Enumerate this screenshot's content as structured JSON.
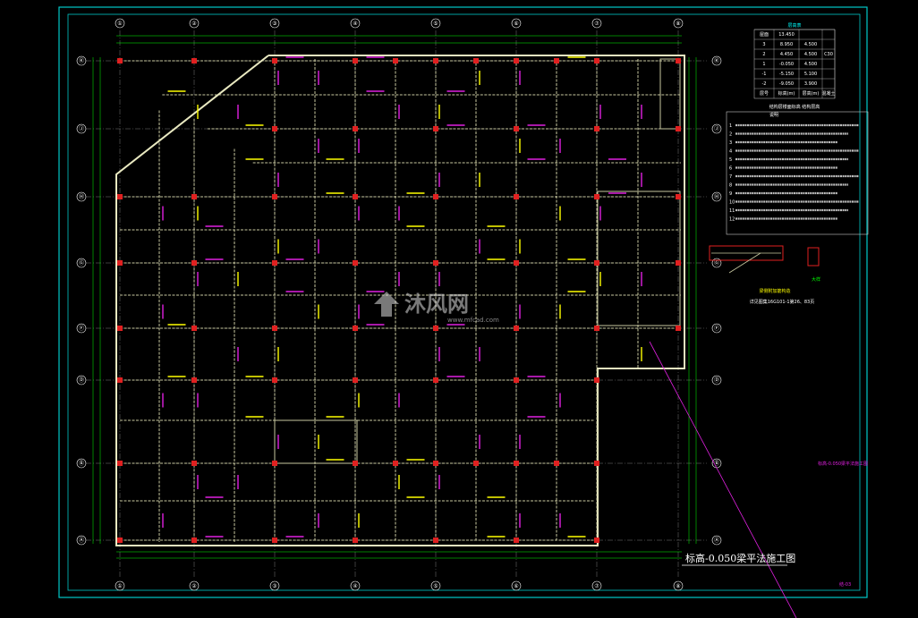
{
  "drawing": {
    "title": "标高-0.050梁平法施工图",
    "grid_columns": [
      "①",
      "②",
      "③",
      "④",
      "⑤",
      "⑥",
      "⑦",
      "⑧"
    ],
    "grid_rows": [
      "Ⓚ",
      "Ⓙ",
      "Ⓗ",
      "Ⓖ",
      "Ⓕ",
      "Ⓓ",
      "Ⓑ",
      "Ⓐ"
    ],
    "side_note": "标高-0.050梁平法施工图",
    "sheet_no": "结-03"
  },
  "level_table": {
    "title": "层高表",
    "rows": [
      [
        "屋面",
        "13.450",
        "",
        ""
      ],
      [
        "3",
        "8.950",
        "4.500",
        ""
      ],
      [
        "2",
        "4.450",
        "4.500",
        "C30"
      ],
      [
        "1",
        "-0.050",
        "4.500",
        ""
      ],
      [
        "-1",
        "-5.150",
        "5.100",
        ""
      ],
      [
        "-2",
        "-9.050",
        "3.900",
        ""
      ],
      [
        "层号",
        "标高(m)",
        "层高(m)",
        "混凝土"
      ]
    ],
    "footer": "结构层楼面标高  结构层高"
  },
  "notes": {
    "title": "说明",
    "count": 12
  },
  "detail": {
    "label_1": "梁侧附加筋构造",
    "label_2": "大样",
    "ref": "详见图集16G101-1第26、83页"
  },
  "watermark": {
    "text": "沐风网",
    "sub": "www.mfcad.com"
  },
  "colors": {
    "background": "#000000",
    "border": "#00c8c8",
    "beam": "#c8c8a0",
    "grid": "#ffffff",
    "column": "#e02020",
    "annotation": "#e020e0",
    "text_yellow": "#ffff00",
    "dimension": "#00ff00"
  }
}
